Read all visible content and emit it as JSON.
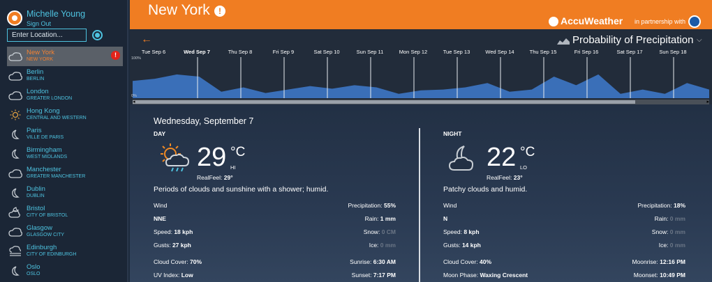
{
  "user": {
    "name": "Michelle Young",
    "signout": "Sign Out"
  },
  "search": {
    "placeholder": "Enter Location..."
  },
  "cities": [
    {
      "name": "New York",
      "region": "NEW YORK",
      "icon": "cloud-icon",
      "selected": true,
      "alert": "!"
    },
    {
      "name": "Berlin",
      "region": "BERLIN",
      "icon": "cloud-icon"
    },
    {
      "name": "London",
      "region": "GREATER LONDON",
      "icon": "cloud-icon"
    },
    {
      "name": "Hong Kong",
      "region": "CENTRAL AND WESTERN",
      "icon": "sun-icon"
    },
    {
      "name": "Paris",
      "region": "VILLE DE PARIS",
      "icon": "moon-icon"
    },
    {
      "name": "Birmingham",
      "region": "WEST MIDLANDS",
      "icon": "moon-icon"
    },
    {
      "name": "Manchester",
      "region": "GREATER MANCHESTER",
      "icon": "cloud-icon"
    },
    {
      "name": "Dublin",
      "region": "DUBLIN",
      "icon": "moon-icon"
    },
    {
      "name": "Bristol",
      "region": "CITY OF BRISTOL",
      "icon": "cloud-moon-icon"
    },
    {
      "name": "Glasgow",
      "region": "GLASGOW CITY",
      "icon": "cloud-icon"
    },
    {
      "name": "Edinburgh",
      "region": "CITY OF EDINBURGH",
      "icon": "fog-icon"
    },
    {
      "name": "Oslo",
      "region": "OSLO",
      "icon": "moon-icon"
    }
  ],
  "header": {
    "city": "New York",
    "alert": "!",
    "brand": "AccuWeather",
    "partner": "in partnership with"
  },
  "chart_selector": {
    "label": "Probability of Precipitation",
    "chevron": "⌵"
  },
  "chart_data": {
    "type": "area",
    "x": [
      "Tue Sep 6",
      "Wed Sep 7",
      "Thu Sep 8",
      "Fri Sep 9",
      "Sat Sep 10",
      "Sun Sep 11",
      "Mon Sep 12",
      "Tue Sep 13",
      "Wed Sep 14",
      "Thu Sep 15",
      "Fri Sep 16",
      "Sat Sep 17",
      "Sun Sep 18"
    ],
    "selected": "Wed Sep 7",
    "ylim": [
      0,
      100
    ],
    "yticks": [
      "100%",
      "0%"
    ],
    "series": [
      {
        "values": [
          40,
          45,
          55,
          50,
          15,
          25,
          12,
          20,
          28,
          22,
          30,
          25,
          10,
          18,
          20,
          25,
          35,
          15,
          20,
          50,
          30,
          55,
          10,
          20,
          10,
          35,
          20
        ]
      }
    ]
  },
  "forecast": {
    "date": "Wednesday, September 7",
    "day": {
      "title": "DAY",
      "temp": "29",
      "unit": "°C",
      "tag": "HI",
      "realfeel_label": "RealFeel:",
      "realfeel": "29°",
      "phrase": "Periods of clouds and sunshine with a shower; humid.",
      "icon": "partly-sunny-showers-icon",
      "wind_label": "Wind",
      "wind_dir": "NNE",
      "speed_label": "Speed:",
      "speed": "18 kph",
      "gusts_label": "Gusts:",
      "gusts": "27 kph",
      "precip_label": "Precipitation:",
      "precip": "55%",
      "rain_label": "Rain:",
      "rain": "1 mm",
      "snow_label": "Snow:",
      "snow": "0 CM",
      "ice_label": "Ice:",
      "ice": "0 mm",
      "cloud_label": "Cloud Cover:",
      "cloud": "70%",
      "sunrise_label": "Sunrise:",
      "sunrise": "6:30 AM",
      "uv_label": "UV Index:",
      "uv": "Low",
      "sunset_label": "Sunset:",
      "sunset": "7:17 PM"
    },
    "night": {
      "title": "NIGHT",
      "temp": "22",
      "unit": "°C",
      "tag": "LO",
      "realfeel_label": "RealFeel:",
      "realfeel": "23°",
      "phrase": "Patchy clouds and humid.",
      "icon": "cloudy-moon-icon",
      "wind_label": "Wind",
      "wind_dir": "N",
      "speed_label": "Speed:",
      "speed": "8 kph",
      "gusts_label": "Gusts:",
      "gusts": "14 kph",
      "precip_label": "Precipitation:",
      "precip": "18%",
      "rain_label": "Rain:",
      "rain": "0 mm",
      "snow_label": "Snow:",
      "snow": "0 mm",
      "ice_label": "Ice:",
      "ice": "0 mm",
      "cloud_label": "Cloud Cover:",
      "cloud": "40%",
      "moonrise_label": "Moonrise:",
      "moonrise": "12:16 PM",
      "phase_label": "Moon Phase:",
      "phase": "Waxing Crescent",
      "moonset_label": "Moonset:",
      "moonset": "10:49 PM"
    }
  },
  "colors": {
    "accent": "#f07d22",
    "link": "#4ec3e0",
    "sidebar": "#1b2636",
    "chart_area": "#3a6fb8"
  }
}
